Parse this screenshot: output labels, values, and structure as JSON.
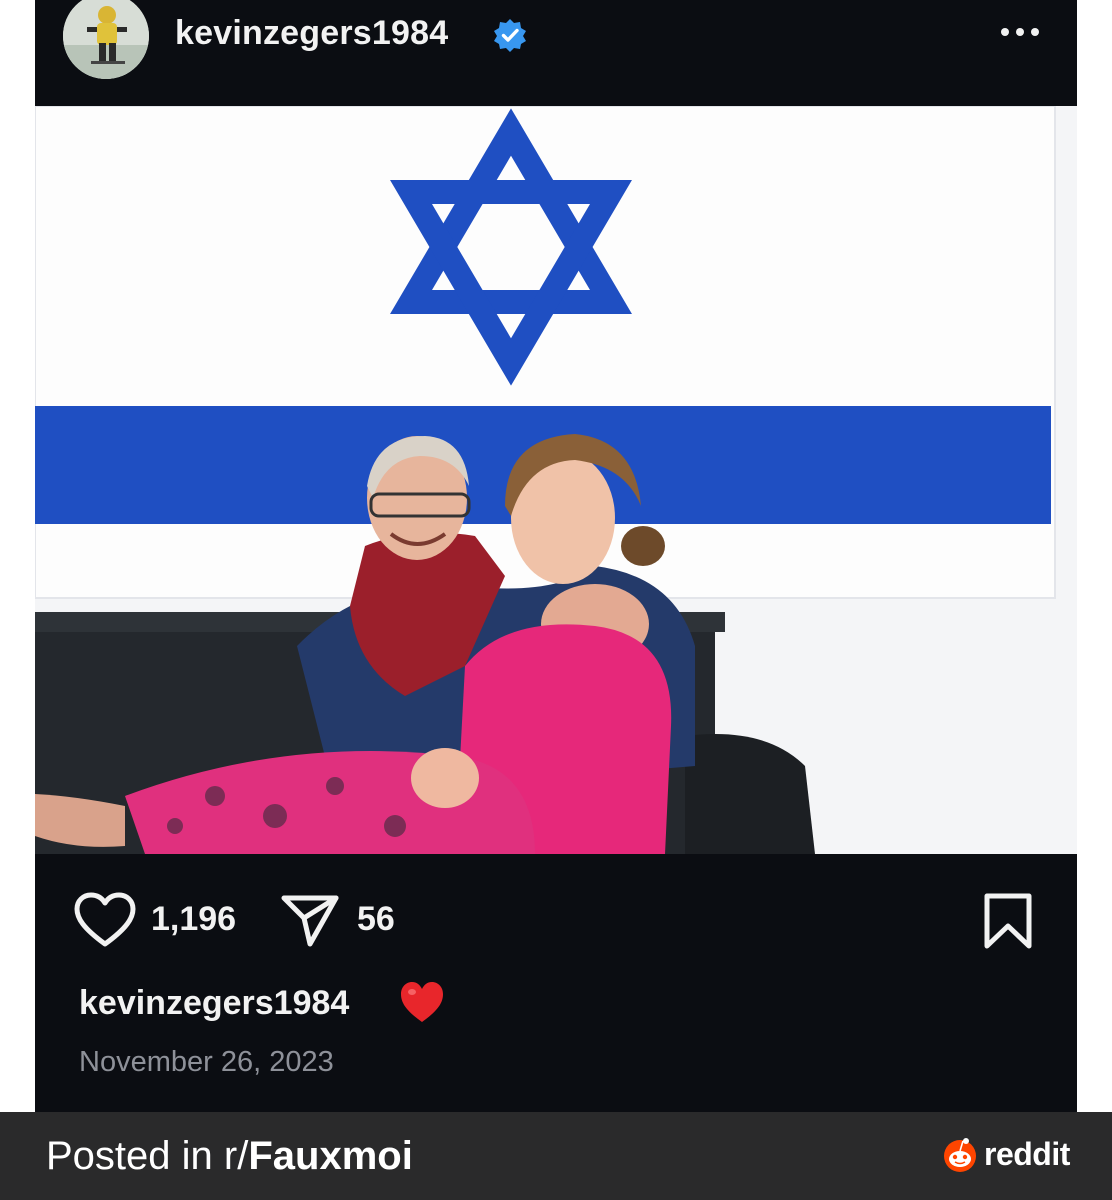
{
  "post": {
    "username": "kevinzegers1984",
    "verified_icon": "verified-badge-icon",
    "more_icon": "more-options-icon",
    "likes": "1,196",
    "shares": "56",
    "caption_username": "kevinzegers1984",
    "caption_emoji": "red-heart",
    "date": "November 26, 2023"
  },
  "footer": {
    "posted_prefix": "Posted in r/",
    "subreddit": "Fauxmoi",
    "brand": "reddit"
  },
  "colors": {
    "post_background": "#0b0d12",
    "verified_blue": "#3897f0",
    "flag_blue": "#1f4fc2",
    "footer_background": "#2a2a2b",
    "reddit_orange": "#ff4500"
  }
}
